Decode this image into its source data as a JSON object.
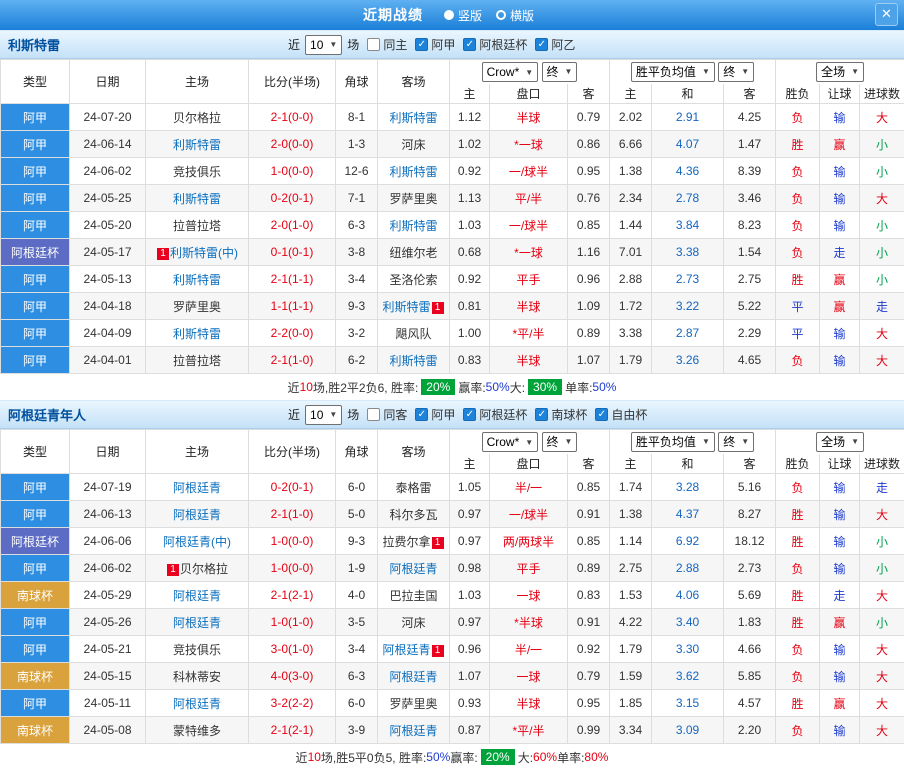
{
  "top_bar": {
    "title": "近期战绩",
    "orientations": [
      {
        "label": "竖版",
        "selected": true
      },
      {
        "label": "横版",
        "selected": false
      }
    ],
    "close": "✕"
  },
  "columns": [
    "类型",
    "日期",
    "主场",
    "比分(半场)",
    "角球",
    "客场",
    "主",
    "盘口",
    "客",
    "主",
    "和",
    "客",
    "胜负",
    "让球",
    "进球数"
  ],
  "colors": {
    "leagues": {
      "阿甲": "#2e8fe2",
      "阿根廷杯": "#5c6cc4",
      "南球杯": "#d9a23c"
    },
    "focus_team": "#0a6ebd",
    "score": "#e60012",
    "handicap": "#e60012",
    "avg_draw": "#1565c0",
    "badge_green": "#00a339",
    "value_colors": {
      "胜": "red",
      "负": "red",
      "平": "blue",
      "赢": "red",
      "输": "blue",
      "走": "blue",
      "大": "red",
      "小": "green"
    }
  },
  "sections": [
    {
      "team": "利斯特雷",
      "filters": {
        "recent_prefix": "近",
        "recent_count": "10",
        "recent_suffix": "场",
        "checkboxes": [
          {
            "label": "同主",
            "checked": false
          },
          {
            "label": "阿甲",
            "checked": true
          },
          {
            "label": "阿根廷杯",
            "checked": true
          },
          {
            "label": "阿乙",
            "checked": true
          }
        ]
      },
      "selects": [
        {
          "value": "Crow*"
        },
        {
          "value": "终"
        },
        {
          "value": "胜平负均值"
        },
        {
          "value": "终"
        },
        {
          "value": "全场"
        }
      ],
      "rows": [
        {
          "league": "阿甲",
          "date": "24-07-20",
          "home": {
            "name": "贝尔格拉"
          },
          "score": "2-1(0-0)",
          "corners": "8-1",
          "away": {
            "name": "利斯特雷",
            "focus": true
          },
          "odds": [
            "1.12",
            "半球",
            "0.79"
          ],
          "avg": [
            "2.02",
            "2.91",
            "4.25"
          ],
          "outcome": [
            "负",
            "输",
            "大"
          ]
        },
        {
          "league": "阿甲",
          "date": "24-06-14",
          "home": {
            "name": "利斯特雷",
            "focus": true
          },
          "score": "2-0(0-0)",
          "corners": "1-3",
          "away": {
            "name": "河床"
          },
          "odds": [
            "1.02",
            "*一球",
            "0.86"
          ],
          "avg": [
            "6.66",
            "4.07",
            "1.47"
          ],
          "outcome": [
            "胜",
            "赢",
            "小"
          ]
        },
        {
          "league": "阿甲",
          "date": "24-06-02",
          "home": {
            "name": "竞技俱乐"
          },
          "score": "1-0(0-0)",
          "corners": "12-6",
          "away": {
            "name": "利斯特雷",
            "focus": true
          },
          "odds": [
            "0.92",
            "一/球半",
            "0.95"
          ],
          "avg": [
            "1.38",
            "4.36",
            "8.39"
          ],
          "outcome": [
            "负",
            "输",
            "小"
          ]
        },
        {
          "league": "阿甲",
          "date": "24-05-25",
          "home": {
            "name": "利斯特雷",
            "focus": true
          },
          "score": "0-2(0-1)",
          "corners": "7-1",
          "away": {
            "name": "罗萨里奥"
          },
          "odds": [
            "1.13",
            "平/半",
            "0.76"
          ],
          "avg": [
            "2.34",
            "2.78",
            "3.46"
          ],
          "outcome": [
            "负",
            "输",
            "大"
          ]
        },
        {
          "league": "阿甲",
          "date": "24-05-20",
          "home": {
            "name": "拉普拉塔"
          },
          "score": "2-0(1-0)",
          "corners": "6-3",
          "away": {
            "name": "利斯特雷",
            "focus": true
          },
          "odds": [
            "1.03",
            "一/球半",
            "0.85"
          ],
          "avg": [
            "1.44",
            "3.84",
            "8.23"
          ],
          "outcome": [
            "负",
            "输",
            "小"
          ]
        },
        {
          "league": "阿根廷杯",
          "date": "24-05-17",
          "home": {
            "name": "利斯特雷(中)",
            "focus": true,
            "badge_before": "1"
          },
          "score": "0-1(0-1)",
          "corners": "3-8",
          "away": {
            "name": "纽维尔老"
          },
          "odds": [
            "0.68",
            "*一球",
            "1.16"
          ],
          "avg": [
            "7.01",
            "3.38",
            "1.54"
          ],
          "outcome": [
            "负",
            "走",
            "小"
          ]
        },
        {
          "league": "阿甲",
          "date": "24-05-13",
          "home": {
            "name": "利斯特雷",
            "focus": true
          },
          "score": "2-1(1-1)",
          "corners": "3-4",
          "away": {
            "name": "圣洛伦索"
          },
          "odds": [
            "0.92",
            "平手",
            "0.96"
          ],
          "avg": [
            "2.88",
            "2.73",
            "2.75"
          ],
          "outcome": [
            "胜",
            "赢",
            "小"
          ]
        },
        {
          "league": "阿甲",
          "date": "24-04-18",
          "home": {
            "name": "罗萨里奥"
          },
          "score": "1-1(1-1)",
          "corners": "9-3",
          "away": {
            "name": "利斯特雷",
            "focus": true,
            "badge_after": "1"
          },
          "odds": [
            "0.81",
            "半球",
            "1.09"
          ],
          "avg": [
            "1.72",
            "3.22",
            "5.22"
          ],
          "outcome": [
            "平",
            "赢",
            "走"
          ]
        },
        {
          "league": "阿甲",
          "date": "24-04-09",
          "home": {
            "name": "利斯特雷",
            "focus": true
          },
          "score": "2-2(0-0)",
          "corners": "3-2",
          "away": {
            "name": "飓风队"
          },
          "odds": [
            "1.00",
            "*平/半",
            "0.89"
          ],
          "avg": [
            "3.38",
            "2.87",
            "2.29"
          ],
          "outcome": [
            "平",
            "输",
            "大"
          ]
        },
        {
          "league": "阿甲",
          "date": "24-04-01",
          "home": {
            "name": "拉普拉塔"
          },
          "score": "2-1(1-0)",
          "corners": "6-2",
          "away": {
            "name": "利斯特雷",
            "focus": true
          },
          "odds": [
            "0.83",
            "半球",
            "1.07"
          ],
          "avg": [
            "1.79",
            "3.26",
            "4.65"
          ],
          "outcome": [
            "负",
            "输",
            "大"
          ]
        }
      ],
      "summary": [
        {
          "t": "近"
        },
        {
          "t": "10",
          "c": "red"
        },
        {
          "t": "场,胜2平2负6, 胜率: "
        },
        {
          "t": "20%",
          "badge": true
        },
        {
          "t": " 赢率:"
        },
        {
          "t": "50%",
          "c": "blue"
        },
        {
          "t": " 大: "
        },
        {
          "t": "30%",
          "badge": true
        },
        {
          "t": " 单率:"
        },
        {
          "t": "50%",
          "c": "blue"
        }
      ]
    },
    {
      "team": "阿根廷青年人",
      "filters": {
        "recent_prefix": "近",
        "recent_count": "10",
        "recent_suffix": "场",
        "checkboxes": [
          {
            "label": "同客",
            "checked": false
          },
          {
            "label": "阿甲",
            "checked": true
          },
          {
            "label": "阿根廷杯",
            "checked": true
          },
          {
            "label": "南球杯",
            "checked": true
          },
          {
            "label": "自由杯",
            "checked": true
          }
        ]
      },
      "selects": [
        {
          "value": "Crow*"
        },
        {
          "value": "终"
        },
        {
          "value": "胜平负均值"
        },
        {
          "value": "终"
        },
        {
          "value": "全场"
        }
      ],
      "rows": [
        {
          "league": "阿甲",
          "date": "24-07-19",
          "home": {
            "name": "阿根廷青",
            "focus": true
          },
          "score": "0-2(0-1)",
          "corners": "6-0",
          "away": {
            "name": "泰格雷"
          },
          "odds": [
            "1.05",
            "半/一",
            "0.85"
          ],
          "avg": [
            "1.74",
            "3.28",
            "5.16"
          ],
          "outcome": [
            "负",
            "输",
            "走"
          ]
        },
        {
          "league": "阿甲",
          "date": "24-06-13",
          "home": {
            "name": "阿根廷青",
            "focus": true
          },
          "score": "2-1(1-0)",
          "corners": "5-0",
          "away": {
            "name": "科尔多瓦"
          },
          "odds": [
            "0.97",
            "一/球半",
            "0.91"
          ],
          "avg": [
            "1.38",
            "4.37",
            "8.27"
          ],
          "outcome": [
            "胜",
            "输",
            "大"
          ]
        },
        {
          "league": "阿根廷杯",
          "date": "24-06-06",
          "home": {
            "name": "阿根廷青(中)",
            "focus": true
          },
          "score": "1-0(0-0)",
          "corners": "9-3",
          "away": {
            "name": "拉费尔拿",
            "badge_after": "1"
          },
          "odds": [
            "0.97",
            "两/两球半",
            "0.85"
          ],
          "avg": [
            "1.14",
            "6.92",
            "18.12"
          ],
          "outcome": [
            "胜",
            "输",
            "小"
          ]
        },
        {
          "league": "阿甲",
          "date": "24-06-02",
          "home": {
            "name": "贝尔格拉",
            "badge_before": "1"
          },
          "score": "1-0(0-0)",
          "corners": "1-9",
          "away": {
            "name": "阿根廷青",
            "focus": true
          },
          "odds": [
            "0.98",
            "平手",
            "0.89"
          ],
          "avg": [
            "2.75",
            "2.88",
            "2.73"
          ],
          "outcome": [
            "负",
            "输",
            "小"
          ]
        },
        {
          "league": "南球杯",
          "date": "24-05-29",
          "home": {
            "name": "阿根廷青",
            "focus": true
          },
          "score": "2-1(2-1)",
          "corners": "4-0",
          "away": {
            "name": "巴拉圭国"
          },
          "odds": [
            "1.03",
            "一球",
            "0.83"
          ],
          "avg": [
            "1.53",
            "4.06",
            "5.69"
          ],
          "outcome": [
            "胜",
            "走",
            "大"
          ]
        },
        {
          "league": "阿甲",
          "date": "24-05-26",
          "home": {
            "name": "阿根廷青",
            "focus": true
          },
          "score": "1-0(1-0)",
          "corners": "3-5",
          "away": {
            "name": "河床"
          },
          "odds": [
            "0.97",
            "*半球",
            "0.91"
          ],
          "avg": [
            "4.22",
            "3.40",
            "1.83"
          ],
          "outcome": [
            "胜",
            "赢",
            "小"
          ]
        },
        {
          "league": "阿甲",
          "date": "24-05-21",
          "home": {
            "name": "竞技俱乐"
          },
          "score": "3-0(1-0)",
          "corners": "3-4",
          "away": {
            "name": "阿根廷青",
            "focus": true,
            "badge_after": "1"
          },
          "odds": [
            "0.96",
            "半/一",
            "0.92"
          ],
          "avg": [
            "1.79",
            "3.30",
            "4.66"
          ],
          "outcome": [
            "负",
            "输",
            "大"
          ]
        },
        {
          "league": "南球杯",
          "date": "24-05-15",
          "home": {
            "name": "科林蒂安"
          },
          "score": "4-0(3-0)",
          "corners": "6-3",
          "away": {
            "name": "阿根廷青",
            "focus": true
          },
          "odds": [
            "1.07",
            "一球",
            "0.79"
          ],
          "avg": [
            "1.59",
            "3.62",
            "5.85"
          ],
          "outcome": [
            "负",
            "输",
            "大"
          ]
        },
        {
          "league": "阿甲",
          "date": "24-05-11",
          "home": {
            "name": "阿根廷青",
            "focus": true
          },
          "score": "3-2(2-2)",
          "corners": "6-0",
          "away": {
            "name": "罗萨里奥"
          },
          "odds": [
            "0.93",
            "半球",
            "0.95"
          ],
          "avg": [
            "1.85",
            "3.15",
            "4.57"
          ],
          "outcome": [
            "胜",
            "赢",
            "大"
          ]
        },
        {
          "league": "南球杯",
          "date": "24-05-08",
          "home": {
            "name": "蒙特维多"
          },
          "score": "2-1(2-1)",
          "corners": "3-9",
          "away": {
            "name": "阿根廷青",
            "focus": true
          },
          "odds": [
            "0.87",
            "*平/半",
            "0.99"
          ],
          "avg": [
            "3.34",
            "3.09",
            "2.20"
          ],
          "outcome": [
            "负",
            "输",
            "大"
          ]
        }
      ],
      "summary": [
        {
          "t": "近"
        },
        {
          "t": "10",
          "c": "red"
        },
        {
          "t": "场,胜5平0负5, 胜率:"
        },
        {
          "t": "50%",
          "c": "blue"
        },
        {
          "t": " 赢率: "
        },
        {
          "t": "20%",
          "badge": true
        },
        {
          "t": " 大:"
        },
        {
          "t": "60%",
          "c": "red"
        },
        {
          "t": " 单率:"
        },
        {
          "t": "80%",
          "c": "red"
        }
      ]
    }
  ]
}
